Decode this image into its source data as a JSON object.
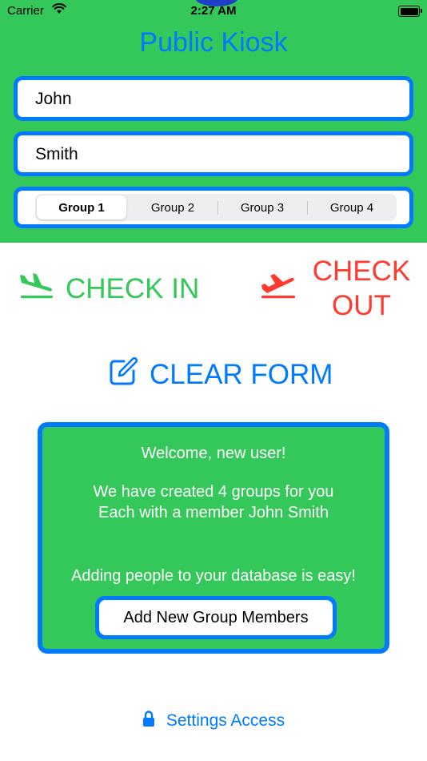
{
  "status_bar": {
    "carrier": "Carrier",
    "time": "2:27 AM",
    "icons": [
      "wifi-icon",
      "battery-icon"
    ]
  },
  "app": {
    "title": "Public Kiosk"
  },
  "form": {
    "first_name": {
      "value": "John"
    },
    "last_name": {
      "value": "Smith"
    },
    "groups": {
      "options": [
        "Group 1",
        "Group 2",
        "Group 3",
        "Group 4"
      ],
      "selected": "Group 1"
    }
  },
  "actions": {
    "check_in": {
      "label": "CHECK IN",
      "icon": "airplane-arrival-icon",
      "color": "#34c759"
    },
    "check_out": {
      "line1": "CHECK",
      "line2": "OUT",
      "icon": "airplane-departure-icon",
      "color": "#ff3b30"
    },
    "clear_form": {
      "label": "CLEAR FORM",
      "icon": "square-pencil-icon",
      "color": "#007aff"
    }
  },
  "welcome_card": {
    "greeting": "Welcome, new user!",
    "line1": "We have created 4 groups for you",
    "line2": "Each with a member John Smith",
    "line3": "Adding people to your database is easy!",
    "button_label": "Add New Group Members"
  },
  "footer": {
    "settings_label": "Settings Access",
    "icon": "lock-icon"
  },
  "colors": {
    "accent": "#007aff",
    "panel_green": "#34c759",
    "check_out_red": "#ff3b30"
  }
}
